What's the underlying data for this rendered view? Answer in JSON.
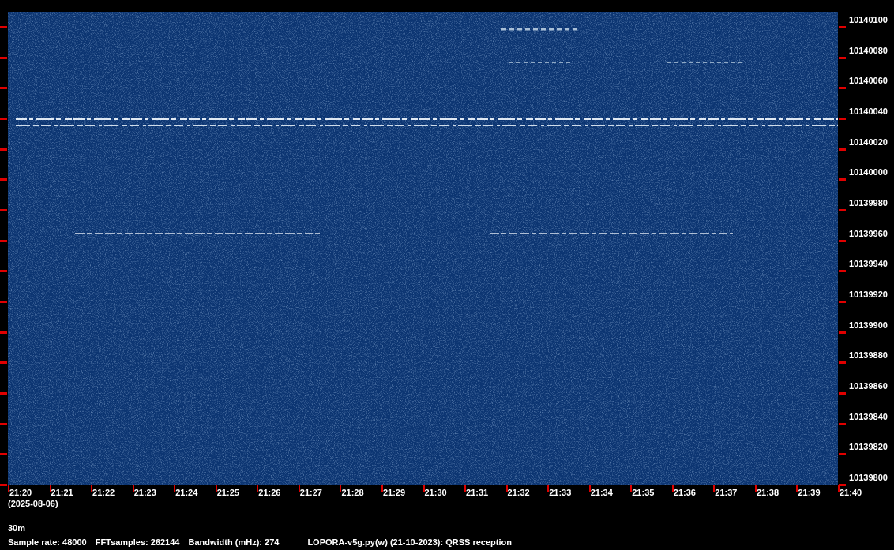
{
  "frequency_axis": [
    "10140100",
    "10140080",
    "10140060",
    "10140040",
    "10140020",
    "10140000",
    "10139980",
    "10139960",
    "10139940",
    "10139920",
    "10139900",
    "10139880",
    "10139860",
    "10139840",
    "10139820",
    "10139800"
  ],
  "time_axis": [
    "21:20",
    "21:21",
    "21:22",
    "21:23",
    "21:24",
    "21:25",
    "21:26",
    "21:27",
    "21:28",
    "21:29",
    "21:30",
    "21:31",
    "21:32",
    "21:33",
    "21:34",
    "21:35",
    "21:36",
    "21:37",
    "21:38",
    "21:39",
    "21:40"
  ],
  "date": "(2025-08-06)",
  "band": "30m",
  "footer": [
    "Sample rate: 48000",
    "FFTsamples: 262144",
    "Bandwidth (mHz): 274",
    "LOPORA-v5g.py(w) (21-10-2023): QRSS reception"
  ]
}
